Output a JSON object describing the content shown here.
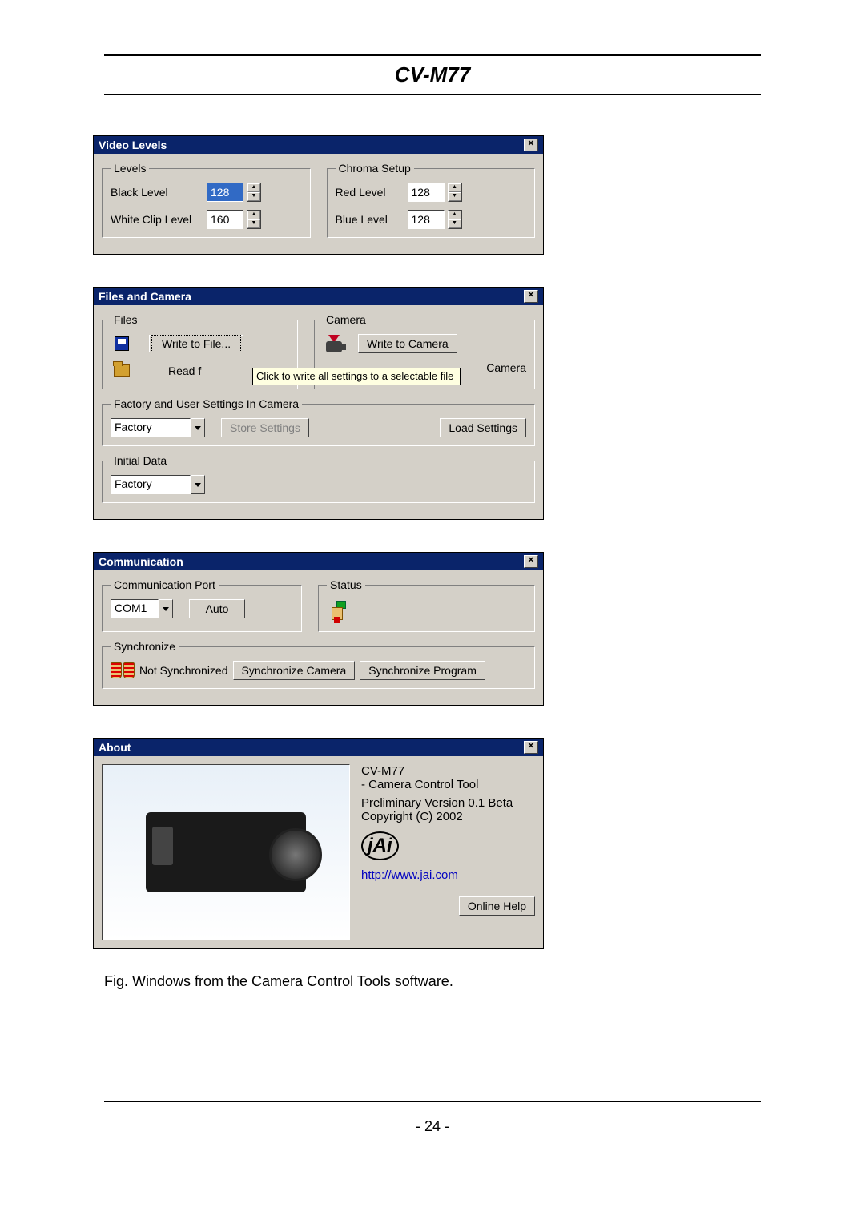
{
  "document": {
    "title": "CV-M77",
    "caption": "Fig.  Windows from the Camera Control Tools software.",
    "page": "- 24 -"
  },
  "video_levels": {
    "title": "Video Levels",
    "levels": {
      "legend": "Levels",
      "black_label": "Black Level",
      "black_value": "128",
      "white_label": "White Clip Level",
      "white_value": "160"
    },
    "chroma": {
      "legend": "Chroma Setup",
      "red_label": "Red Level",
      "red_value": "128",
      "blue_label": "Blue Level",
      "blue_value": "128"
    }
  },
  "files_camera": {
    "title": "Files and Camera",
    "files_legend": "Files",
    "camera_legend": "Camera",
    "write_to_file": "Write to File...",
    "read_prefix": "Read f",
    "write_to_camera": "Write to Camera",
    "read_camera_suffix": "Camera",
    "tooltip": "Click to write all settings to a selectable file",
    "factory_legend": "Factory and User Settings In Camera",
    "factory_sel": "Factory",
    "store": "Store Settings",
    "load": "Load Settings",
    "initial_legend": "Initial Data",
    "initial_sel": "Factory"
  },
  "communication": {
    "title": "Communication",
    "port_legend": "Communication Port",
    "port_sel": "COM1",
    "auto": "Auto",
    "status_legend": "Status",
    "sync_legend": "Synchronize",
    "not_sync": "Not Synchronized",
    "sync_camera": "Synchronize Camera",
    "sync_program": "Synchronize Program"
  },
  "about": {
    "title": "About",
    "product": "CV-M77",
    "desc": "- Camera Control Tool",
    "version": "Preliminary Version 0.1 Beta",
    "copyright": "Copyright (C) 2002",
    "url": "http://www.jai.com",
    "help": "Online Help"
  }
}
